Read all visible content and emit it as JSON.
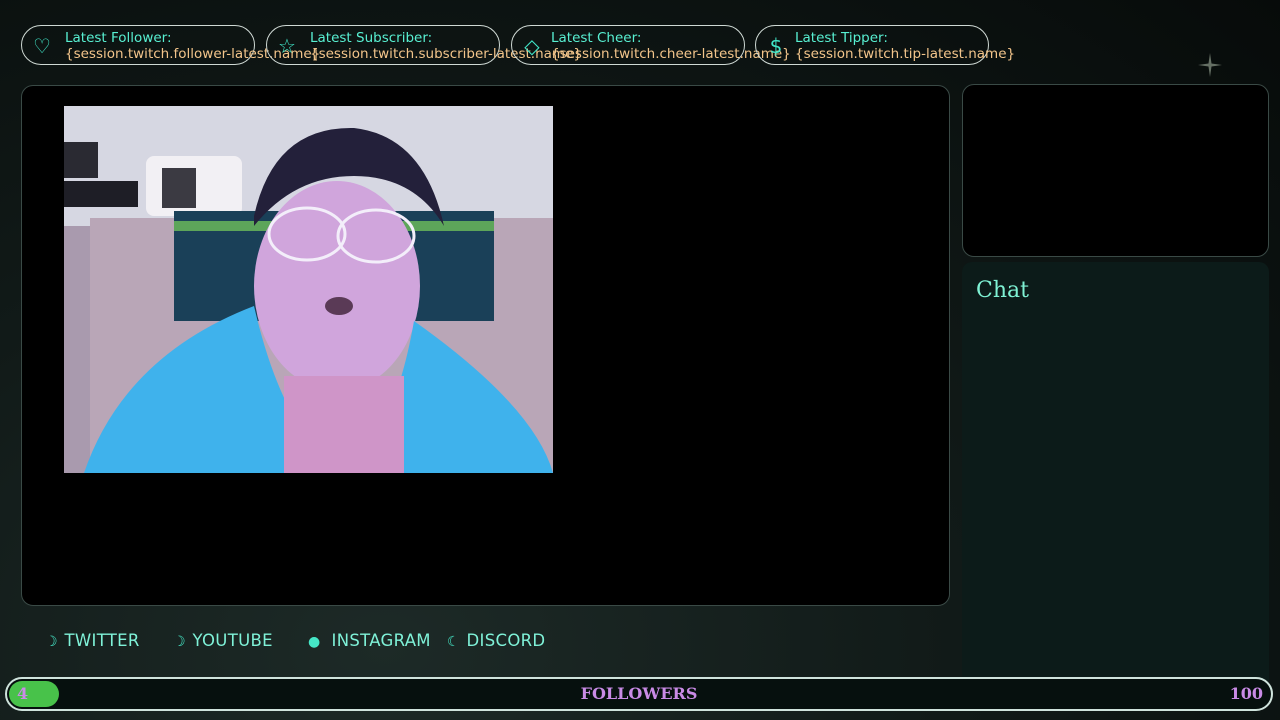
{
  "alerts": [
    {
      "icon": "heart-icon",
      "glyph": "♡",
      "title": "Latest Follower:",
      "value": "{session.twitch.follower-latest.name}"
    },
    {
      "icon": "star-icon",
      "glyph": "☆",
      "title": "Latest Subscriber:",
      "value": "{session.twitch.subscriber-latest.name}"
    },
    {
      "icon": "diamond-icon",
      "glyph": "◇",
      "title": "Latest Cheer:",
      "value": "{session.twitch.cheer-latest.name}"
    },
    {
      "icon": "dollar-icon",
      "glyph": "$",
      "title": "Latest Tipper:",
      "value": "{session.twitch.tip-latest.name}"
    }
  ],
  "chat": {
    "title": "Chat"
  },
  "socials": [
    {
      "icon": "moon-icon",
      "glyph": "☽",
      "label": "TWITTER"
    },
    {
      "icon": "moon-icon",
      "glyph": "☽",
      "label": "YOUTUBE"
    },
    {
      "icon": "full-moon-icon",
      "glyph": "●",
      "label": "INSTAGRAM"
    },
    {
      "icon": "moon-icon",
      "glyph": "☾",
      "label": "DISCORD"
    }
  ],
  "followers": {
    "label": "FOLLOWERS",
    "current": "4",
    "goal": "100",
    "progress_fraction": 0.04
  },
  "colors": {
    "accent": "#58f0d2",
    "value": "#f3c58b",
    "bar_fill": "#48c24a",
    "bar_text": "#c98be6"
  }
}
